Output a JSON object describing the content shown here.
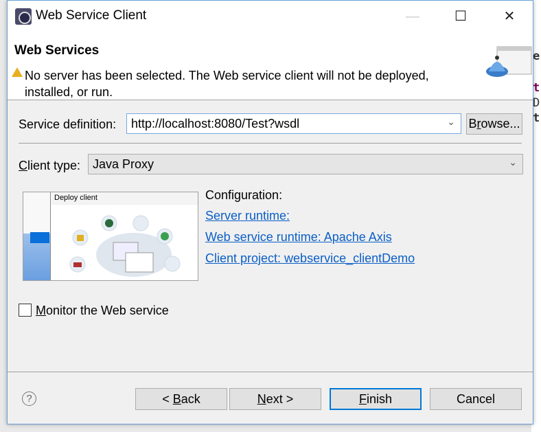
{
  "window": {
    "title": "Web Service Client",
    "minimize": "—",
    "maximize": "☐",
    "close": "✕"
  },
  "header": {
    "title": "Web Services",
    "message": "No server has been selected. The Web service client will not be deployed, installed, or run.",
    "icon": "warning-icon"
  },
  "service_definition": {
    "label": "Service definition:",
    "value": "http://localhost:8080/Test?wsdl",
    "browse_pre": "B",
    "browse_mn": "r",
    "browse_post": "owse..."
  },
  "client_type": {
    "label_mn": "C",
    "label_rest": "lient type:",
    "value": "Java Proxy"
  },
  "preview": {
    "caption": "Deploy client",
    "slider_level": "Deploy client"
  },
  "configuration": {
    "label": "Configuration:",
    "server_runtime": "Server runtime: ",
    "ws_runtime": "Web service runtime: Apache Axis",
    "client_project": "Client project: webservice_clientDemo"
  },
  "monitor": {
    "mn": "M",
    "rest": "onitor the Web service",
    "checked": false
  },
  "buttons": {
    "back_pre": "< ",
    "back_mn": "B",
    "back_post": "ack",
    "next_mn": "N",
    "next_post": "ext >",
    "finish_mn": "F",
    "finish_post": "inish",
    "cancel": "Cancel",
    "help": "?"
  },
  "background_text": [
    "e",
    "t",
    "D",
    "t"
  ],
  "colors": {
    "link": "#0b5fc7",
    "focus": "#0078d7"
  }
}
